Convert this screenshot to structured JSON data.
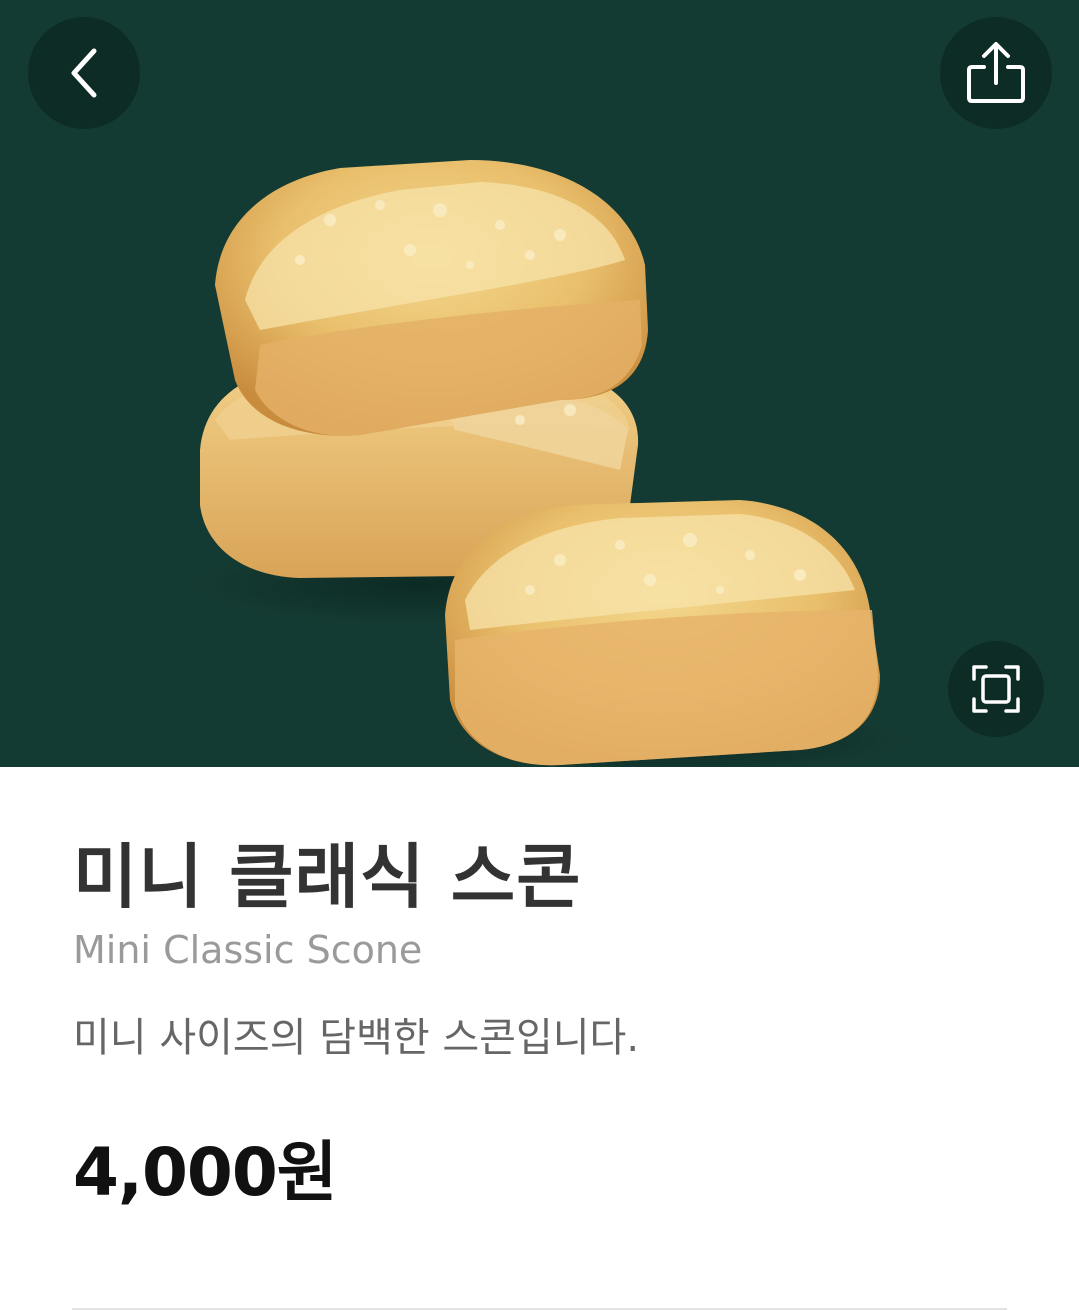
{
  "product": {
    "name_ko": "미니 클래식 스콘",
    "name_en": "Mini Classic Scone",
    "description": "미니 사이즈의 담백한 스콘입니다.",
    "price": "4,000원"
  },
  "icons": {
    "back": "chevron-left-icon",
    "share": "share-icon",
    "expand": "expand-icon"
  },
  "colors": {
    "hero_background": "#143b33",
    "title": "#333333",
    "subtitle": "#9a9a9a",
    "description": "#666666",
    "price": "#111111"
  }
}
